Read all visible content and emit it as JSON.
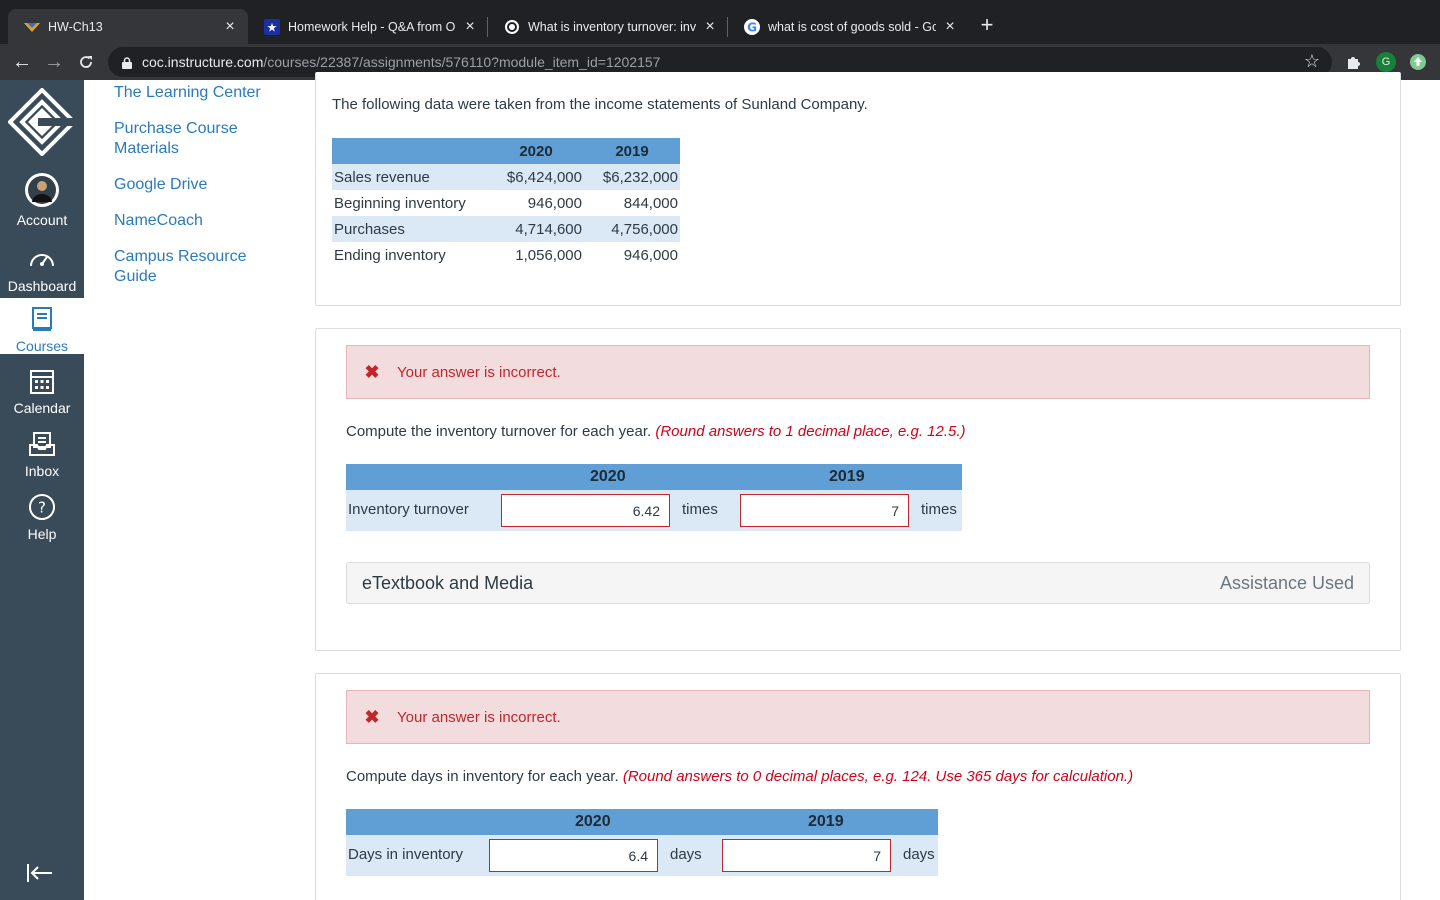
{
  "browser": {
    "tabs": [
      {
        "title": "HW-Ch13",
        "active": true
      },
      {
        "title": "Homework Help - Q&A from Or",
        "active": false
      },
      {
        "title": "What is inventory turnover: inv",
        "active": false
      },
      {
        "title": "what is cost of goods sold - Go",
        "active": false
      }
    ],
    "url_host": "coc.instructure.com",
    "url_path": "/courses/22387/assignments/576110?module_item_id=1202157",
    "profile_initial": "G"
  },
  "global_nav": {
    "items": [
      {
        "label": "Account",
        "icon": "avatar"
      },
      {
        "label": "Dashboard",
        "icon": "dashboard-icon"
      },
      {
        "label": "Courses",
        "icon": "courses-icon",
        "active": true
      },
      {
        "label": "Calendar",
        "icon": "calendar-icon"
      },
      {
        "label": "Inbox",
        "icon": "inbox-icon"
      },
      {
        "label": "Help",
        "icon": "help-icon"
      }
    ]
  },
  "course_nav": {
    "links": [
      "The Learning Center",
      "Purchase Course Materials",
      "Google Drive",
      "NameCoach",
      "Campus Resource Guide"
    ]
  },
  "data_card": {
    "intro": "The following data were taken from the income statements of Sunland Company.",
    "columns": [
      "2020",
      "2019"
    ],
    "rows": [
      {
        "label": "Sales revenue",
        "v2020": "$6,424,000",
        "v2019": "$6,232,000"
      },
      {
        "label": "Beginning inventory",
        "v2020": "946,000",
        "v2019": "844,000"
      },
      {
        "label": "Purchases",
        "v2020": "4,714,600",
        "v2019": "4,756,000"
      },
      {
        "label": "Ending inventory",
        "v2020": "1,056,000",
        "v2019": "946,000"
      }
    ]
  },
  "q1": {
    "alert": "Your answer is incorrect.",
    "question": "Compute the inventory turnover for each year.",
    "hint": "(Round answers to 1 decimal place, e.g. 12.5.)",
    "col_2020": "2020",
    "col_2019": "2019",
    "row_label": "Inventory turnover",
    "answer_2020": "6.42",
    "answer_2019": "7",
    "unit": "times",
    "etext": "eTextbook and Media",
    "assistance": "Assistance Used"
  },
  "q2": {
    "alert": "Your answer is incorrect.",
    "question": "Compute days in inventory for each year.",
    "hint": "(Round answers to 0 decimal places, e.g. 124. Use 365 days for calculation.)",
    "col_2020": "2020",
    "col_2019": "2019",
    "row_label": "Days in inventory",
    "answer_2020": "6.4",
    "answer_2019": "7",
    "unit": "days"
  }
}
